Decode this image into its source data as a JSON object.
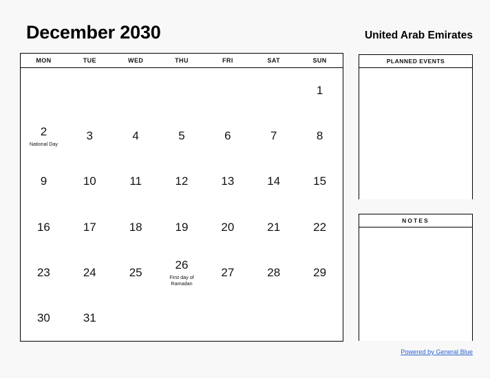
{
  "header": {
    "month_title": "December 2030",
    "country": "United Arab Emirates"
  },
  "calendar": {
    "weekday_headers": [
      "MON",
      "TUE",
      "WED",
      "THU",
      "FRI",
      "SAT",
      "SUN"
    ],
    "weeks": [
      [
        {
          "day": "",
          "event": ""
        },
        {
          "day": "",
          "event": ""
        },
        {
          "day": "",
          "event": ""
        },
        {
          "day": "",
          "event": ""
        },
        {
          "day": "",
          "event": ""
        },
        {
          "day": "",
          "event": ""
        },
        {
          "day": "1",
          "event": ""
        }
      ],
      [
        {
          "day": "2",
          "event": "National Day"
        },
        {
          "day": "3",
          "event": ""
        },
        {
          "day": "4",
          "event": ""
        },
        {
          "day": "5",
          "event": ""
        },
        {
          "day": "6",
          "event": ""
        },
        {
          "day": "7",
          "event": ""
        },
        {
          "day": "8",
          "event": ""
        }
      ],
      [
        {
          "day": "9",
          "event": ""
        },
        {
          "day": "10",
          "event": ""
        },
        {
          "day": "11",
          "event": ""
        },
        {
          "day": "12",
          "event": ""
        },
        {
          "day": "13",
          "event": ""
        },
        {
          "day": "14",
          "event": ""
        },
        {
          "day": "15",
          "event": ""
        }
      ],
      [
        {
          "day": "16",
          "event": ""
        },
        {
          "day": "17",
          "event": ""
        },
        {
          "day": "18",
          "event": ""
        },
        {
          "day": "19",
          "event": ""
        },
        {
          "day": "20",
          "event": ""
        },
        {
          "day": "21",
          "event": ""
        },
        {
          "day": "22",
          "event": ""
        }
      ],
      [
        {
          "day": "23",
          "event": ""
        },
        {
          "day": "24",
          "event": ""
        },
        {
          "day": "25",
          "event": ""
        },
        {
          "day": "26",
          "event": "First day of\nRamadan"
        },
        {
          "day": "27",
          "event": ""
        },
        {
          "day": "28",
          "event": ""
        },
        {
          "day": "29",
          "event": ""
        }
      ],
      [
        {
          "day": "30",
          "event": ""
        },
        {
          "day": "31",
          "event": ""
        },
        {
          "day": "",
          "event": ""
        },
        {
          "day": "",
          "event": ""
        },
        {
          "day": "",
          "event": ""
        },
        {
          "day": "",
          "event": ""
        },
        {
          "day": "",
          "event": ""
        }
      ]
    ]
  },
  "panels": {
    "planned_events": {
      "title": "PLANNED EVENTS",
      "content": ""
    },
    "notes": {
      "title": "NOTES",
      "content": ""
    }
  },
  "footer": {
    "link_label": "Powered by General Blue",
    "link_color": "#2a62d0"
  }
}
